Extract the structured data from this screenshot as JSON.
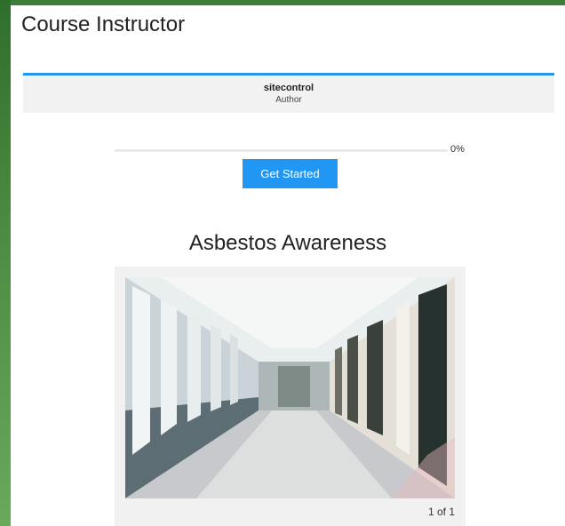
{
  "page": {
    "title": "Course Instructor"
  },
  "instructor": {
    "name": "sitecontrol",
    "role": "Author"
  },
  "progress": {
    "percent_text": "0%",
    "fraction": 0
  },
  "actions": {
    "start_label": "Get Started"
  },
  "course": {
    "title": "Asbestos Awareness",
    "slide_counter": "1 of 1"
  },
  "colors": {
    "accent": "#2196f3",
    "background_green": "#3f7f3a"
  }
}
